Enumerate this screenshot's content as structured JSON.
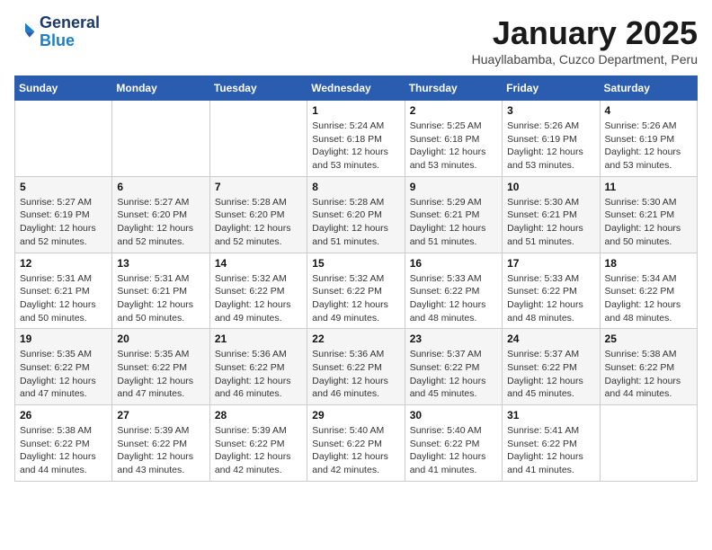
{
  "logo": {
    "line1": "General",
    "line2": "Blue"
  },
  "title": "January 2025",
  "subtitle": "Huayllabamba, Cuzco Department, Peru",
  "days_of_week": [
    "Sunday",
    "Monday",
    "Tuesday",
    "Wednesday",
    "Thursday",
    "Friday",
    "Saturday"
  ],
  "weeks": [
    [
      {
        "day": "",
        "info": ""
      },
      {
        "day": "",
        "info": ""
      },
      {
        "day": "",
        "info": ""
      },
      {
        "day": "1",
        "info": "Sunrise: 5:24 AM\nSunset: 6:18 PM\nDaylight: 12 hours\nand 53 minutes."
      },
      {
        "day": "2",
        "info": "Sunrise: 5:25 AM\nSunset: 6:18 PM\nDaylight: 12 hours\nand 53 minutes."
      },
      {
        "day": "3",
        "info": "Sunrise: 5:26 AM\nSunset: 6:19 PM\nDaylight: 12 hours\nand 53 minutes."
      },
      {
        "day": "4",
        "info": "Sunrise: 5:26 AM\nSunset: 6:19 PM\nDaylight: 12 hours\nand 53 minutes."
      }
    ],
    [
      {
        "day": "5",
        "info": "Sunrise: 5:27 AM\nSunset: 6:19 PM\nDaylight: 12 hours\nand 52 minutes."
      },
      {
        "day": "6",
        "info": "Sunrise: 5:27 AM\nSunset: 6:20 PM\nDaylight: 12 hours\nand 52 minutes."
      },
      {
        "day": "7",
        "info": "Sunrise: 5:28 AM\nSunset: 6:20 PM\nDaylight: 12 hours\nand 52 minutes."
      },
      {
        "day": "8",
        "info": "Sunrise: 5:28 AM\nSunset: 6:20 PM\nDaylight: 12 hours\nand 51 minutes."
      },
      {
        "day": "9",
        "info": "Sunrise: 5:29 AM\nSunset: 6:21 PM\nDaylight: 12 hours\nand 51 minutes."
      },
      {
        "day": "10",
        "info": "Sunrise: 5:30 AM\nSunset: 6:21 PM\nDaylight: 12 hours\nand 51 minutes."
      },
      {
        "day": "11",
        "info": "Sunrise: 5:30 AM\nSunset: 6:21 PM\nDaylight: 12 hours\nand 50 minutes."
      }
    ],
    [
      {
        "day": "12",
        "info": "Sunrise: 5:31 AM\nSunset: 6:21 PM\nDaylight: 12 hours\nand 50 minutes."
      },
      {
        "day": "13",
        "info": "Sunrise: 5:31 AM\nSunset: 6:21 PM\nDaylight: 12 hours\nand 50 minutes."
      },
      {
        "day": "14",
        "info": "Sunrise: 5:32 AM\nSunset: 6:22 PM\nDaylight: 12 hours\nand 49 minutes."
      },
      {
        "day": "15",
        "info": "Sunrise: 5:32 AM\nSunset: 6:22 PM\nDaylight: 12 hours\nand 49 minutes."
      },
      {
        "day": "16",
        "info": "Sunrise: 5:33 AM\nSunset: 6:22 PM\nDaylight: 12 hours\nand 48 minutes."
      },
      {
        "day": "17",
        "info": "Sunrise: 5:33 AM\nSunset: 6:22 PM\nDaylight: 12 hours\nand 48 minutes."
      },
      {
        "day": "18",
        "info": "Sunrise: 5:34 AM\nSunset: 6:22 PM\nDaylight: 12 hours\nand 48 minutes."
      }
    ],
    [
      {
        "day": "19",
        "info": "Sunrise: 5:35 AM\nSunset: 6:22 PM\nDaylight: 12 hours\nand 47 minutes."
      },
      {
        "day": "20",
        "info": "Sunrise: 5:35 AM\nSunset: 6:22 PM\nDaylight: 12 hours\nand 47 minutes."
      },
      {
        "day": "21",
        "info": "Sunrise: 5:36 AM\nSunset: 6:22 PM\nDaylight: 12 hours\nand 46 minutes."
      },
      {
        "day": "22",
        "info": "Sunrise: 5:36 AM\nSunset: 6:22 PM\nDaylight: 12 hours\nand 46 minutes."
      },
      {
        "day": "23",
        "info": "Sunrise: 5:37 AM\nSunset: 6:22 PM\nDaylight: 12 hours\nand 45 minutes."
      },
      {
        "day": "24",
        "info": "Sunrise: 5:37 AM\nSunset: 6:22 PM\nDaylight: 12 hours\nand 45 minutes."
      },
      {
        "day": "25",
        "info": "Sunrise: 5:38 AM\nSunset: 6:22 PM\nDaylight: 12 hours\nand 44 minutes."
      }
    ],
    [
      {
        "day": "26",
        "info": "Sunrise: 5:38 AM\nSunset: 6:22 PM\nDaylight: 12 hours\nand 44 minutes."
      },
      {
        "day": "27",
        "info": "Sunrise: 5:39 AM\nSunset: 6:22 PM\nDaylight: 12 hours\nand 43 minutes."
      },
      {
        "day": "28",
        "info": "Sunrise: 5:39 AM\nSunset: 6:22 PM\nDaylight: 12 hours\nand 42 minutes."
      },
      {
        "day": "29",
        "info": "Sunrise: 5:40 AM\nSunset: 6:22 PM\nDaylight: 12 hours\nand 42 minutes."
      },
      {
        "day": "30",
        "info": "Sunrise: 5:40 AM\nSunset: 6:22 PM\nDaylight: 12 hours\nand 41 minutes."
      },
      {
        "day": "31",
        "info": "Sunrise: 5:41 AM\nSunset: 6:22 PM\nDaylight: 12 hours\nand 41 minutes."
      },
      {
        "day": "",
        "info": ""
      }
    ]
  ]
}
